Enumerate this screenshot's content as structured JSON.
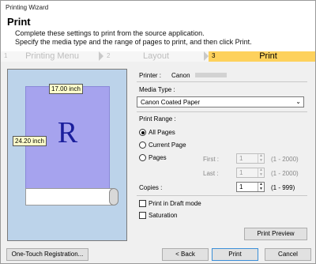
{
  "window": {
    "title": "Printing Wizard"
  },
  "header": {
    "title": "Print",
    "desc1": "Complete these settings to print from the source application.",
    "desc2": "Specify the media type and the range of pages to print, and then click Print."
  },
  "steps": [
    {
      "num": "1",
      "label": "Printing Menu"
    },
    {
      "num": "2",
      "label": "Layout"
    },
    {
      "num": "3",
      "label": "Print"
    }
  ],
  "preview": {
    "width": "17.00 inch",
    "height": "24.20 inch",
    "letter": "R"
  },
  "printer": {
    "label": "Printer :",
    "value": "Canon"
  },
  "media": {
    "label": "Media Type :",
    "value": "Canon Coated Paper"
  },
  "range": {
    "label": "Print Range :",
    "all": "All Pages",
    "current": "Current Page",
    "pages": "Pages",
    "first_label": "First :",
    "first_value": "1",
    "first_range": "(1 - 2000)",
    "last_label": "Last :",
    "last_value": "1",
    "last_range": "(1 - 2000)"
  },
  "copies": {
    "label": "Copies :",
    "value": "1",
    "range": "(1 - 999)"
  },
  "options": {
    "draft": "Print in Draft mode",
    "saturation": "Saturation"
  },
  "buttons": {
    "preview": "Print Preview",
    "one_touch": "One-Touch Registration...",
    "back": "< Back",
    "print": "Print",
    "cancel": "Cancel"
  }
}
